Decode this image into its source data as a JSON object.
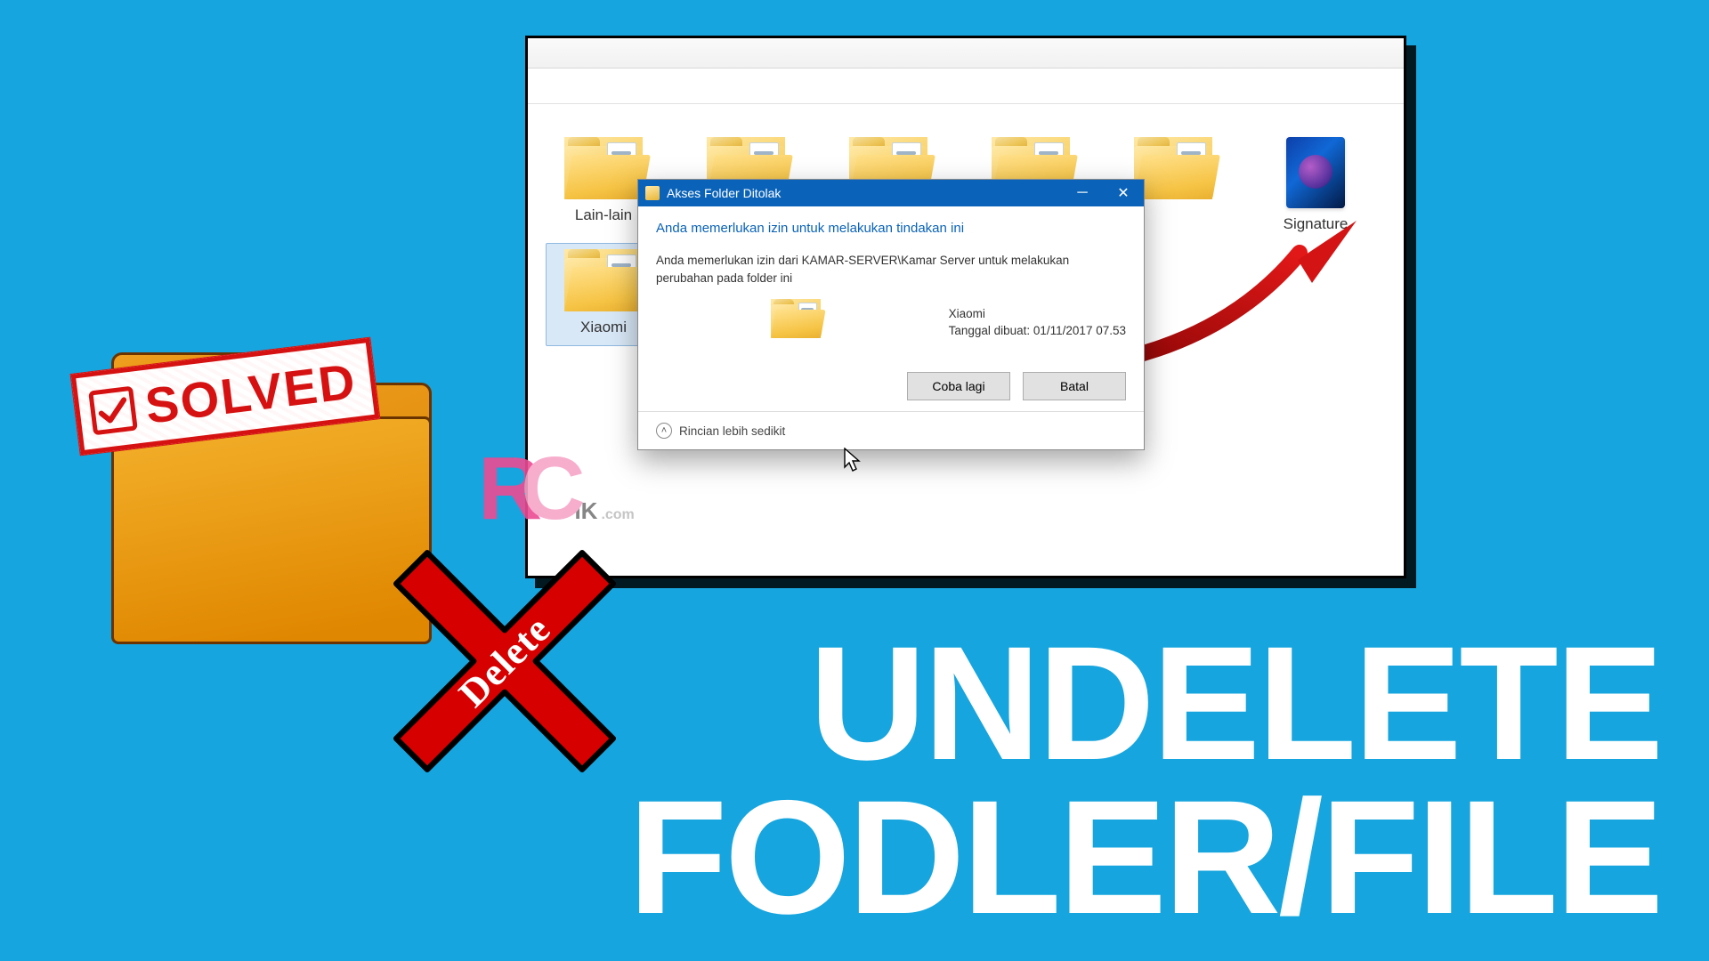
{
  "explorer": {
    "folders": [
      "Lain-lain",
      "",
      "",
      "",
      "",
      "Signature",
      "Xiaomi"
    ],
    "selected_index": 6
  },
  "dialog": {
    "title": "Akses Folder Ditolak",
    "headline": "Anda memerlukan izin untuk melakukan tindakan ini",
    "message": "Anda memerlukan izin dari KAMAR-SERVER\\Kamar Server untuk melakukan perubahan pada folder ini",
    "object_name": "Xiaomi",
    "object_date": "Tanggal dibuat: 01/11/2017 07.53",
    "retry_label": "Coba lagi",
    "cancel_label": "Batal",
    "details_label": "Rincian lebih sedikit"
  },
  "stamp": {
    "label": "SOLVED"
  },
  "delete_badge": {
    "label": "Delete"
  },
  "headline": {
    "line1": "UNDELETE",
    "line2": "FODLER/FILE"
  },
  "watermark": {
    "r": "R",
    "c": "C",
    "ik": "IK",
    "com": ".com"
  }
}
